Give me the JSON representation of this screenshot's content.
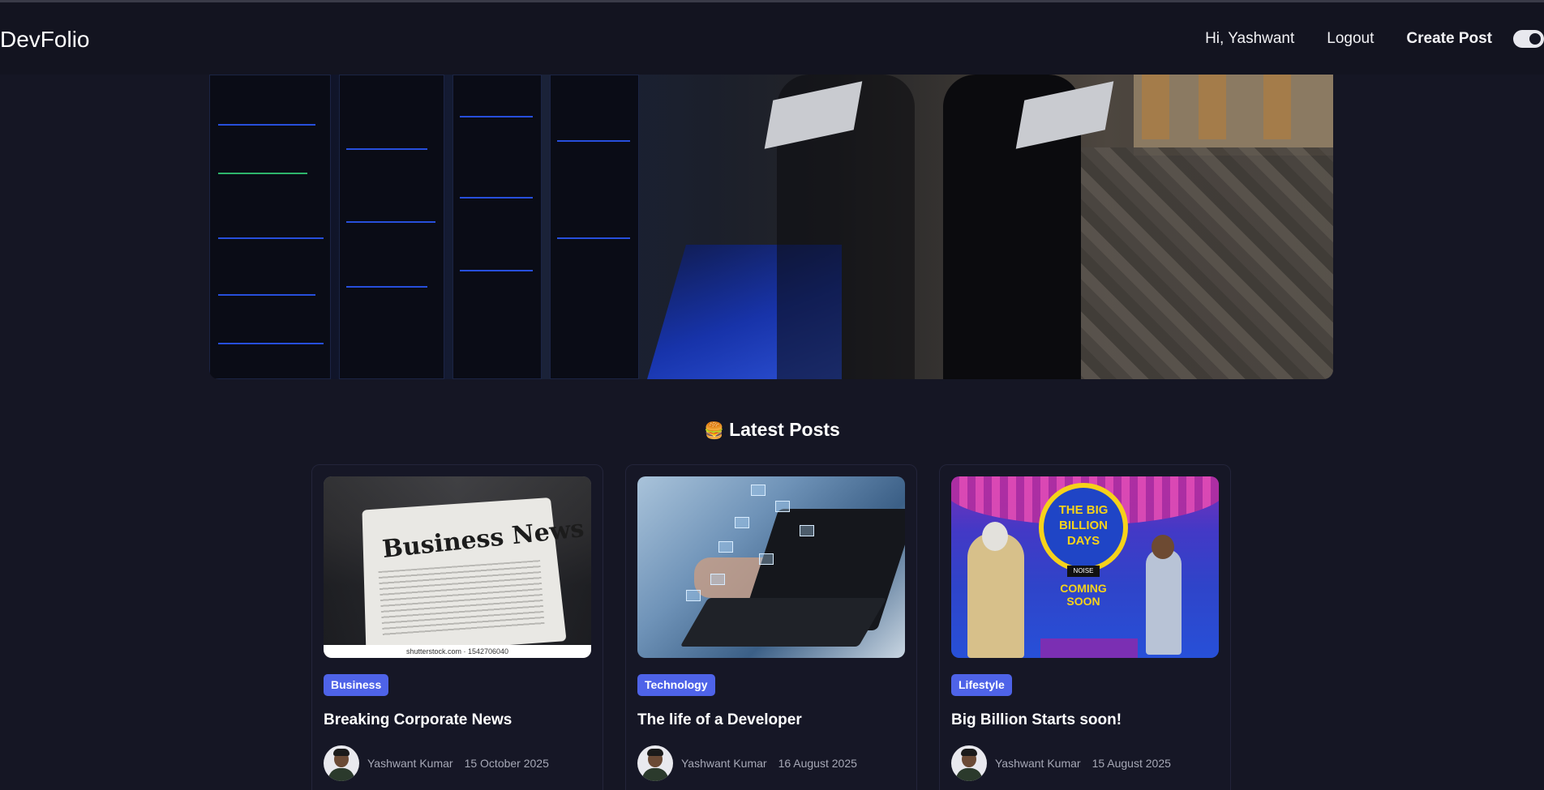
{
  "header": {
    "brand": "DevFolio",
    "greeting": "Hi, Yashwant",
    "logout_label": "Logout",
    "create_post_label": "Create Post",
    "theme_toggle": "dark-mode-toggle"
  },
  "hero": {
    "image": "server-room-hero-image"
  },
  "main": {
    "section_emoji": "🍔",
    "section_title": "Latest Posts"
  },
  "posts": [
    {
      "category": "Business",
      "title": "Breaking Corporate News",
      "author": "Yashwant Kumar",
      "date": "15 October 2025",
      "image": "business-newspaper-image",
      "image_text": "Business News",
      "image_credit": "shutterstock.com · 1542706040"
    },
    {
      "category": "Technology",
      "title": "The life of a Developer",
      "author": "Yashwant Kumar",
      "date": "16 August 2025",
      "image": "developer-laptop-image"
    },
    {
      "category": "Lifestyle",
      "title": "Big Billion Starts soon!",
      "author": "Yashwant Kumar",
      "date": "15 August 2025",
      "image": "big-billion-days-banner-image",
      "image_text": "THE BIG BILLION DAYS",
      "image_sponsor": "NOISE",
      "image_subtext": "COMING SOON"
    }
  ],
  "colors": {
    "background": "#151624",
    "navbar": "#131420",
    "card": "#161726",
    "tag": "#4e63e8",
    "muted_text": "#a6a8b6"
  }
}
